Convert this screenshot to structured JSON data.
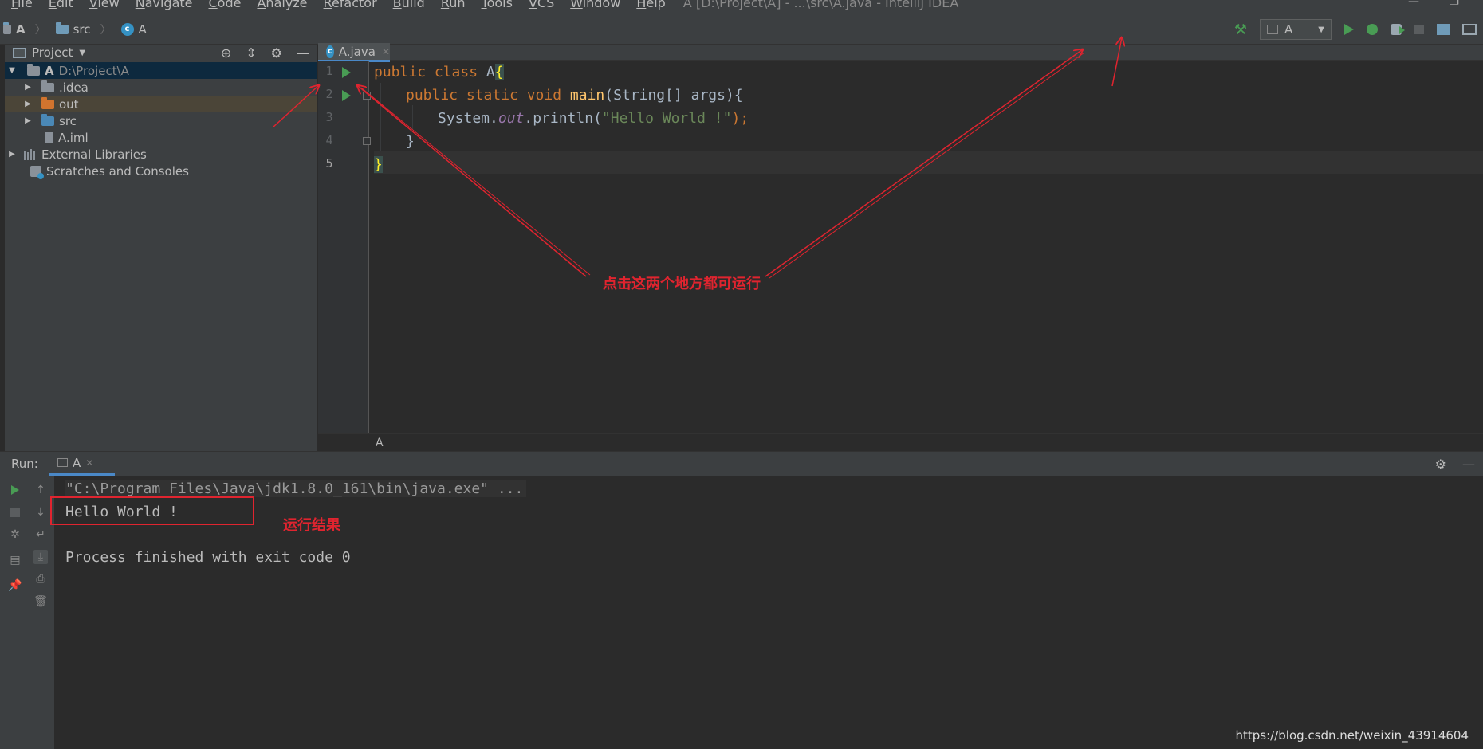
{
  "menubar": {
    "items": [
      "File",
      "Edit",
      "View",
      "Navigate",
      "Code",
      "Analyze",
      "Refactor",
      "Build",
      "Run",
      "Tools",
      "VCS",
      "Window",
      "Help"
    ],
    "title": "A [D:\\Project\\A] - ...\\src\\A.java - IntelliJ IDEA"
  },
  "navbar": {
    "crumbs": [
      "A",
      "src",
      "A"
    ],
    "run_config": "A"
  },
  "project_panel": {
    "title": "Project",
    "root_name": "A",
    "root_path": "D:\\Project\\A",
    "items": [
      ".idea",
      "out",
      "src",
      "A.iml"
    ],
    "external_libraries": "External Libraries",
    "scratches": "Scratches and Consoles"
  },
  "editor": {
    "tab": "A.java",
    "line_numbers": [
      "1",
      "2",
      "3",
      "4",
      "5"
    ],
    "lines": {
      "l1_kw": "public class ",
      "l1_name": "A",
      "l1_brace": "{",
      "l2_kw": "public static void ",
      "l2_fn": "main",
      "l2_rest": "(String[] args){",
      "l3_a": "System.",
      "l3_out": "out",
      "l3_b": ".println(",
      "l3_str": "\"Hello World !\"",
      "l3_c": ");",
      "l4": "}",
      "l5": "}"
    },
    "footer": "A"
  },
  "annotations": {
    "run_hint": "点击这两个地方都可运行",
    "result_hint": "运行结果"
  },
  "run_panel": {
    "label": "Run:",
    "tab": "A",
    "console": {
      "cmd": "\"C:\\Program Files\\Java\\jdk1.8.0_161\\bin\\java.exe\" ...",
      "output": "Hello World !",
      "exit": "Process finished with exit code 0"
    }
  },
  "watermark": "https://blog.csdn.net/weixin_43914604",
  "colors": {
    "annotation": "#e0242f",
    "run_green": "#499c54"
  }
}
